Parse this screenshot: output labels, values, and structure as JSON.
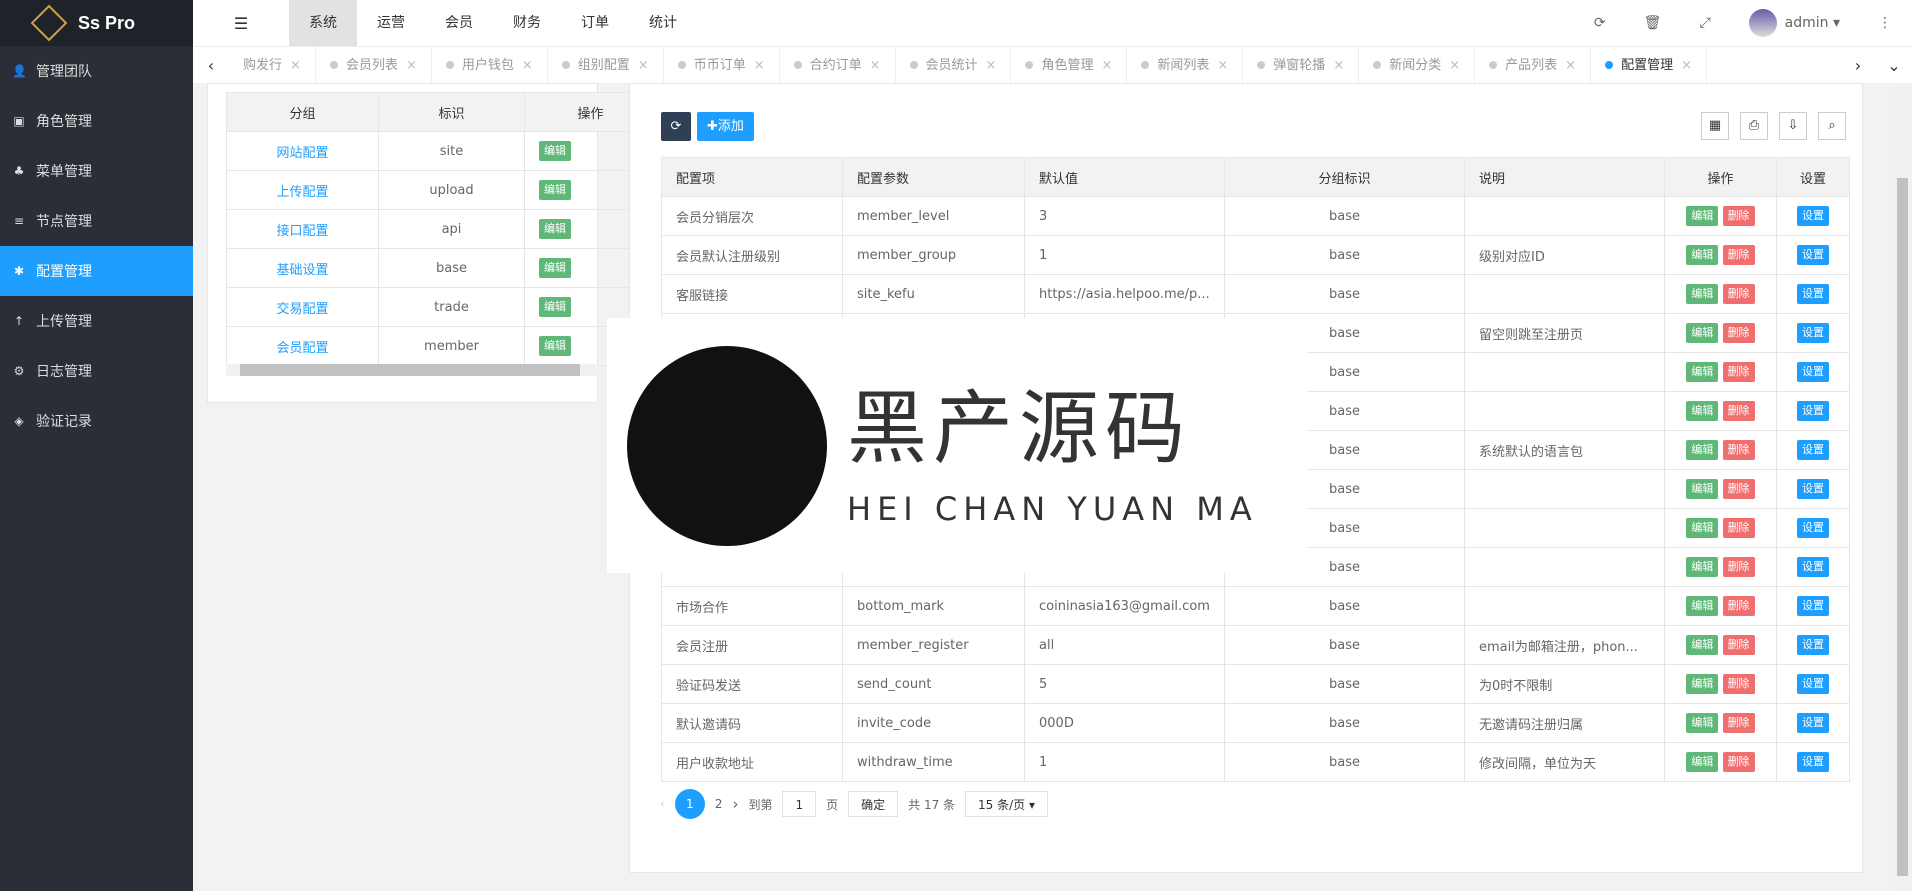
{
  "app": {
    "title": "Ss Pro"
  },
  "sidebar": {
    "items": [
      {
        "label": "管理团队",
        "icon": "user-icon"
      },
      {
        "label": "角色管理",
        "icon": "id-card-icon"
      },
      {
        "label": "菜单管理",
        "icon": "tree-icon"
      },
      {
        "label": "节点管理",
        "icon": "list-icon"
      },
      {
        "label": "配置管理",
        "icon": "gear-icon",
        "active": true
      },
      {
        "label": "上传管理",
        "icon": "upload-icon"
      },
      {
        "label": "日志管理",
        "icon": "log-icon"
      },
      {
        "label": "验证记录",
        "icon": "verify-icon"
      }
    ]
  },
  "topnav": {
    "items": [
      "系统",
      "运营",
      "会员",
      "财务",
      "订单",
      "统计"
    ],
    "active": 0,
    "user": "admin"
  },
  "tabs": [
    {
      "label": "购发行"
    },
    {
      "label": "会员列表"
    },
    {
      "label": "用户钱包"
    },
    {
      "label": "组别配置"
    },
    {
      "label": "币币订单"
    },
    {
      "label": "合约订单"
    },
    {
      "label": "会员统计"
    },
    {
      "label": "角色管理"
    },
    {
      "label": "新闻列表"
    },
    {
      "label": "弹窗轮播"
    },
    {
      "label": "新闻分类"
    },
    {
      "label": "产品列表"
    },
    {
      "label": "配置管理",
      "active": true
    }
  ],
  "groups": {
    "headers": [
      "分组",
      "标识",
      "操作"
    ],
    "edit": "编辑",
    "rows": [
      [
        "网站配置",
        "site"
      ],
      [
        "上传配置",
        "upload"
      ],
      [
        "接口配置",
        "api"
      ],
      [
        "基础设置",
        "base"
      ],
      [
        "交易配置",
        "trade"
      ],
      [
        "会员配置",
        "member"
      ]
    ]
  },
  "toolbar": {
    "add": "添加"
  },
  "config": {
    "headers": [
      "配置项",
      "配置参数",
      "默认值",
      "分组标识",
      "说明",
      "操作",
      "设置"
    ],
    "edit": "编辑",
    "delete": "删除",
    "set": "设置",
    "rows": [
      [
        "会员分销层次",
        "member_level",
        "3",
        "base",
        ""
      ],
      [
        "会员默认注册级别",
        "member_group",
        "1",
        "base",
        "级别对应ID"
      ],
      [
        "客服链接",
        "site_kefu",
        "https://asia.helpoo.me/p...",
        "base",
        ""
      ],
      [
        "",
        "",
        "",
        "base",
        "留空则跳至注册页"
      ],
      [
        "",
        "",
        "",
        "base",
        ""
      ],
      [
        "",
        "",
        "",
        "base",
        ""
      ],
      [
        "",
        "",
        "",
        "base",
        "系统默认的语言包"
      ],
      [
        "",
        "",
        "",
        "base",
        ""
      ],
      [
        "",
        "",
        "",
        "base",
        ""
      ],
      [
        "",
        "",
        "",
        "base",
        ""
      ],
      [
        "市场合作",
        "bottom_mark",
        "coininasia163@gmail.com",
        "base",
        ""
      ],
      [
        "会员注册",
        "member_register",
        "all",
        "base",
        "email为邮箱注册，phon..."
      ],
      [
        "验证码发送",
        "send_count",
        "5",
        "base",
        "为0时不限制"
      ],
      [
        "默认邀请码",
        "invite_code",
        "000D",
        "base",
        "无邀请码注册归属"
      ],
      [
        "用户收款地址",
        "withdraw_time",
        "1",
        "base",
        "修改间隔，单位为天"
      ]
    ]
  },
  "pagination": {
    "current": "1",
    "next": "2",
    "goto": "到第",
    "page_input": "1",
    "page_unit": "页",
    "confirm": "确定",
    "total": "共 17 条",
    "per_page": "15 条/页"
  },
  "overlay": {
    "title": "黑产源码",
    "subtitle": "HEI CHAN YUAN MA"
  }
}
